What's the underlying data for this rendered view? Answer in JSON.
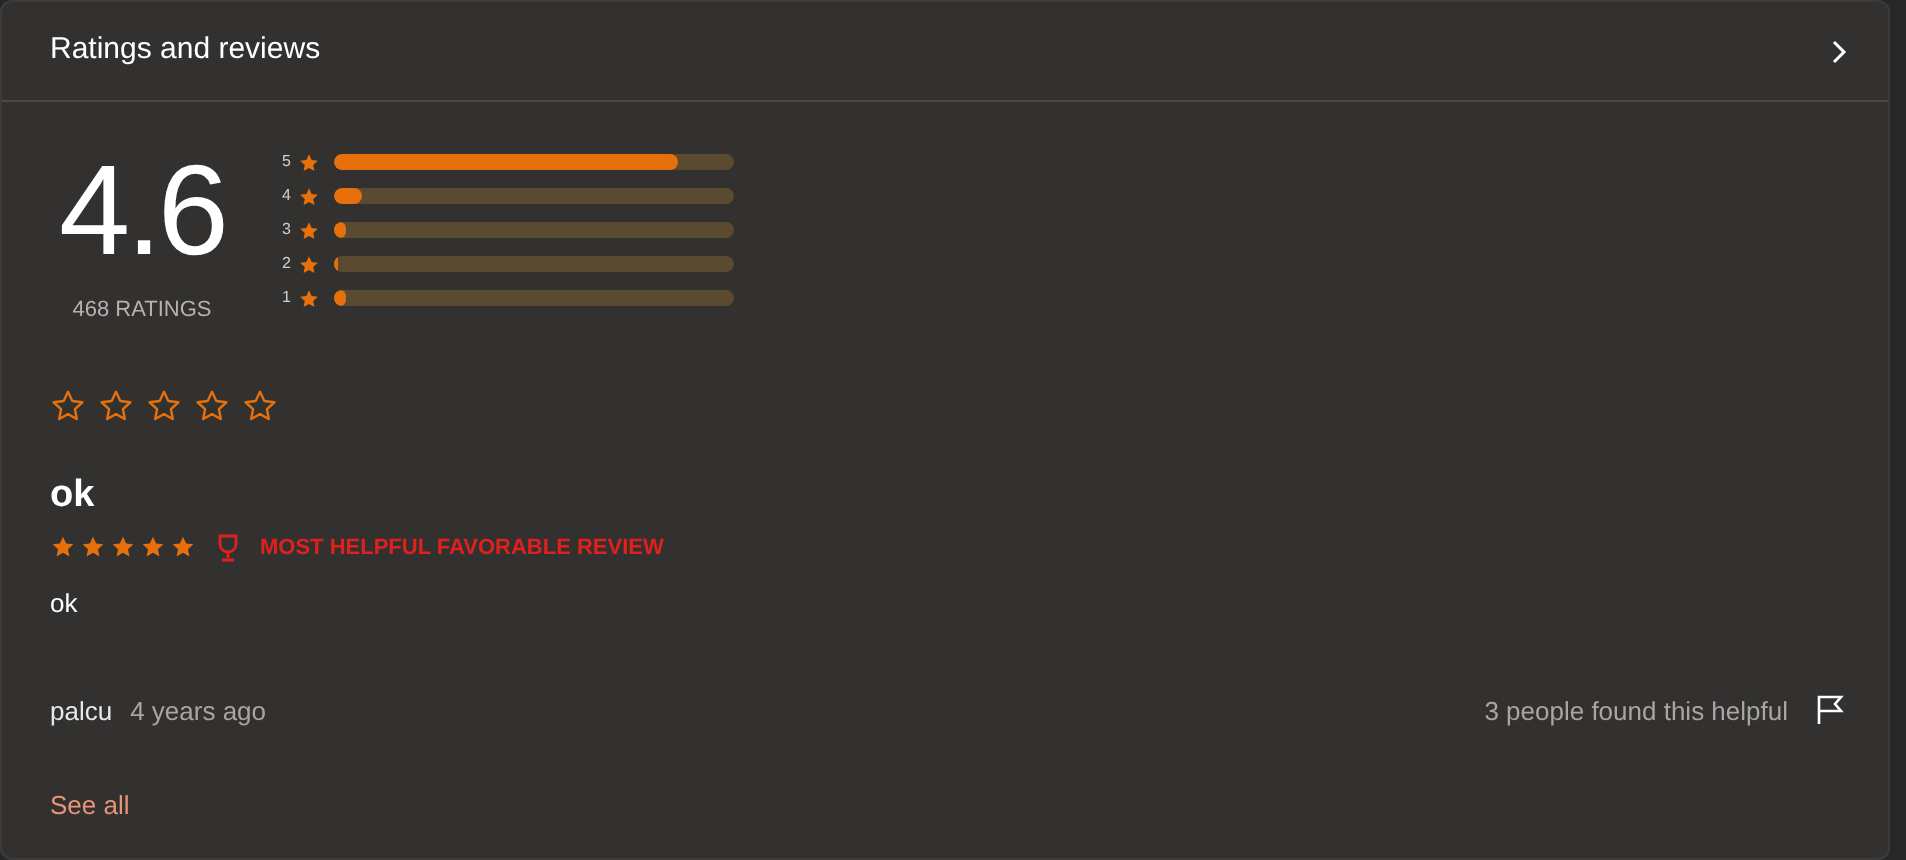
{
  "header": {
    "title": "Ratings and reviews"
  },
  "summary": {
    "average": "4.6",
    "count": "468 RATINGS"
  },
  "histogram": [
    {
      "label": "5",
      "level": 0.86
    },
    {
      "label": "4",
      "level": 0.07
    },
    {
      "label": "3",
      "level": 0.03
    },
    {
      "label": "2",
      "level": 0.005
    },
    {
      "label": "1",
      "level": 0.03
    }
  ],
  "your_rating": {
    "stars": 0
  },
  "review": {
    "title": "ok",
    "stars": 5,
    "badge": "MOST HELPFUL FAVORABLE REVIEW",
    "body": "ok",
    "author": "palcu",
    "time": "4 years ago",
    "helpful": "3 people found this helpful"
  },
  "see_all": "See all"
}
